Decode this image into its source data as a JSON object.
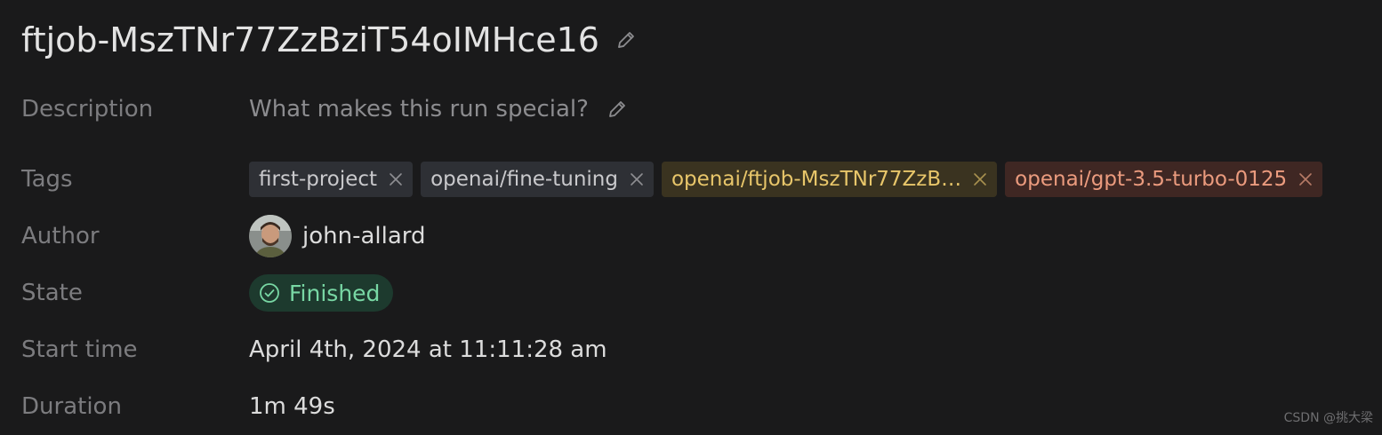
{
  "run": {
    "title": "ftjob-MszTNr77ZzBziT54oIMHce16"
  },
  "fields": {
    "description": {
      "label": "Description",
      "placeholder": "What makes this run special?"
    },
    "tags": {
      "label": "Tags",
      "items": [
        {
          "text": "first-project",
          "style": "gray"
        },
        {
          "text": "openai/fine-tuning",
          "style": "gray"
        },
        {
          "text": "openai/ftjob-MszTNr77ZzB…",
          "style": "yellow"
        },
        {
          "text": "openai/gpt-3.5-turbo-0125",
          "style": "red"
        }
      ]
    },
    "author": {
      "label": "Author",
      "name": "john-allard"
    },
    "state": {
      "label": "State",
      "value": "Finished"
    },
    "start_time": {
      "label": "Start time",
      "value": "April 4th, 2024 at 11:11:28 am"
    },
    "duration": {
      "label": "Duration",
      "value": "1m 49s"
    }
  },
  "watermark": "CSDN @挑大梁",
  "icons": {
    "title_edit": "pencil-icon",
    "description_edit": "pencil-icon",
    "tag_remove": "close-icon",
    "state": "check-circle-icon"
  },
  "colors": {
    "background": "#1a1a1b",
    "label": "#7c7c7f",
    "tag_gray_bg": "#2e3035",
    "tag_yellow_bg": "#3a3320",
    "tag_yellow_text": "#e8c66a",
    "tag_red_bg": "#3f2723",
    "tag_red_text": "#eb9b7e",
    "state_bg": "#1d3a2e",
    "state_text": "#78d7a4"
  }
}
